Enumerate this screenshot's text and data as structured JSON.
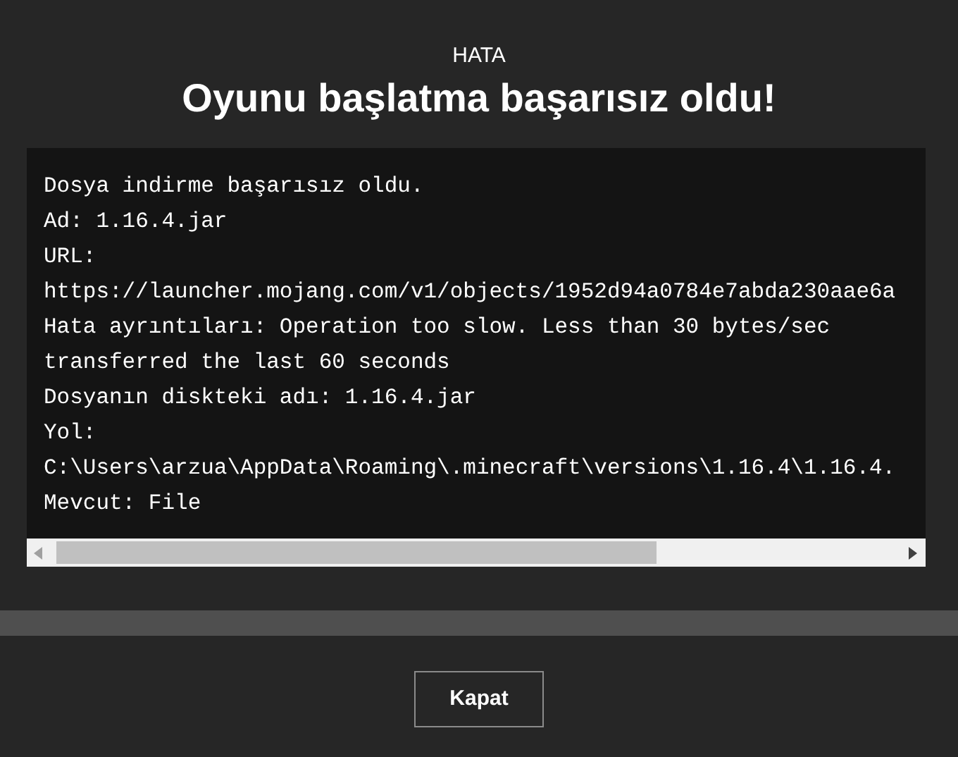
{
  "dialog": {
    "label": "HATA",
    "title": "Oyunu başlatma başarısız oldu!"
  },
  "log": {
    "lines": [
      "Dosya indirme başarısız oldu.",
      "Ad: 1.16.4.jar",
      "URL:",
      "https://launcher.mojang.com/v1/objects/1952d94a0784e7abda230aae6a",
      "Hata ayrıntıları: Operation too slow. Less than 30 bytes/sec transferred the last 60 seconds",
      "Dosyanın diskteki adı: 1.16.4.jar",
      "Yol:",
      "C:\\Users\\arzua\\AppData\\Roaming\\.minecraft\\versions\\1.16.4\\1.16.4.",
      "Mevcut: File"
    ]
  },
  "buttons": [
    "Kapat"
  ]
}
